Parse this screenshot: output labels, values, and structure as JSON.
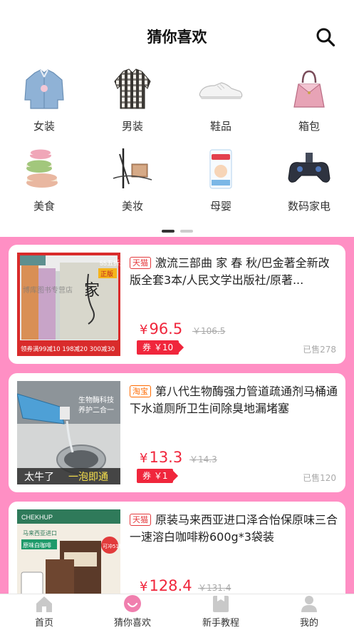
{
  "header": {
    "title": "猜你喜欢",
    "search_icon": "search-icon"
  },
  "categories": [
    {
      "label": "女装",
      "icon": "denim-jacket-image"
    },
    {
      "label": "男装",
      "icon": "plaid-shirt-image"
    },
    {
      "label": "鞋品",
      "icon": "white-sneaker-image"
    },
    {
      "label": "箱包",
      "icon": "handbag-image"
    },
    {
      "label": "美食",
      "icon": "macaron-image"
    },
    {
      "label": "美妆",
      "icon": "makeup-brush-image"
    },
    {
      "label": "母婴",
      "icon": "diaper-pack-image"
    },
    {
      "label": "数码家电",
      "icon": "gaming-controller-image"
    }
  ],
  "pager": {
    "pages": 2,
    "current": 1
  },
  "products": [
    {
      "platform": "天猫",
      "title": "激流三部曲 家 春 秋/巴金著全新改版全套3本/人民文学出版社/原著...",
      "price": "96.5",
      "original_price": "￥106.5",
      "coupon": "券 ￥10",
      "sold": "已售278",
      "thumb": {
        "corner_badge": "55五折天",
        "stamp": "正版",
        "big_char": "家",
        "footer": "领券满99减10 198减20 300减30",
        "watermark": "博库图书专营店"
      }
    },
    {
      "platform": "淘宝",
      "title": "第八代生物酶强力管道疏通剂马桶通下水道厕所卫生间除臭地漏堵塞",
      "price": "13.3",
      "original_price": "￥14.3",
      "coupon": "券 ￥1",
      "sold": "已售120",
      "thumb": {
        "tagline1": "生物酶科技",
        "tagline2": "养护二合一",
        "caption_left": "太牛了",
        "caption_right": "一泡即通"
      }
    },
    {
      "platform": "天猫",
      "title": "原装马来西亚进口泽合怡保原味三合一速溶白咖啡粉600g*3袋装",
      "price": "128.4",
      "original_price": "￥131.4",
      "thumb": {
        "brand": "CHEKHUP",
        "tag": "原味白咖啡",
        "origin": "马来西亚进口",
        "promo": "可冲51杯"
      }
    }
  ],
  "tabbar": [
    {
      "label": "首页",
      "icon": "home-icon"
    },
    {
      "label": "猜你喜欢",
      "icon": "guess-like-icon",
      "active": true
    },
    {
      "label": "新手教程",
      "icon": "tutorial-icon"
    },
    {
      "label": "我的",
      "icon": "profile-icon"
    }
  ],
  "colors": {
    "price_red": "#f0263c",
    "feed_bg": "#ff8fc4",
    "tmall_red": "#e4393c",
    "taobao_orange": "#ff6a00"
  }
}
